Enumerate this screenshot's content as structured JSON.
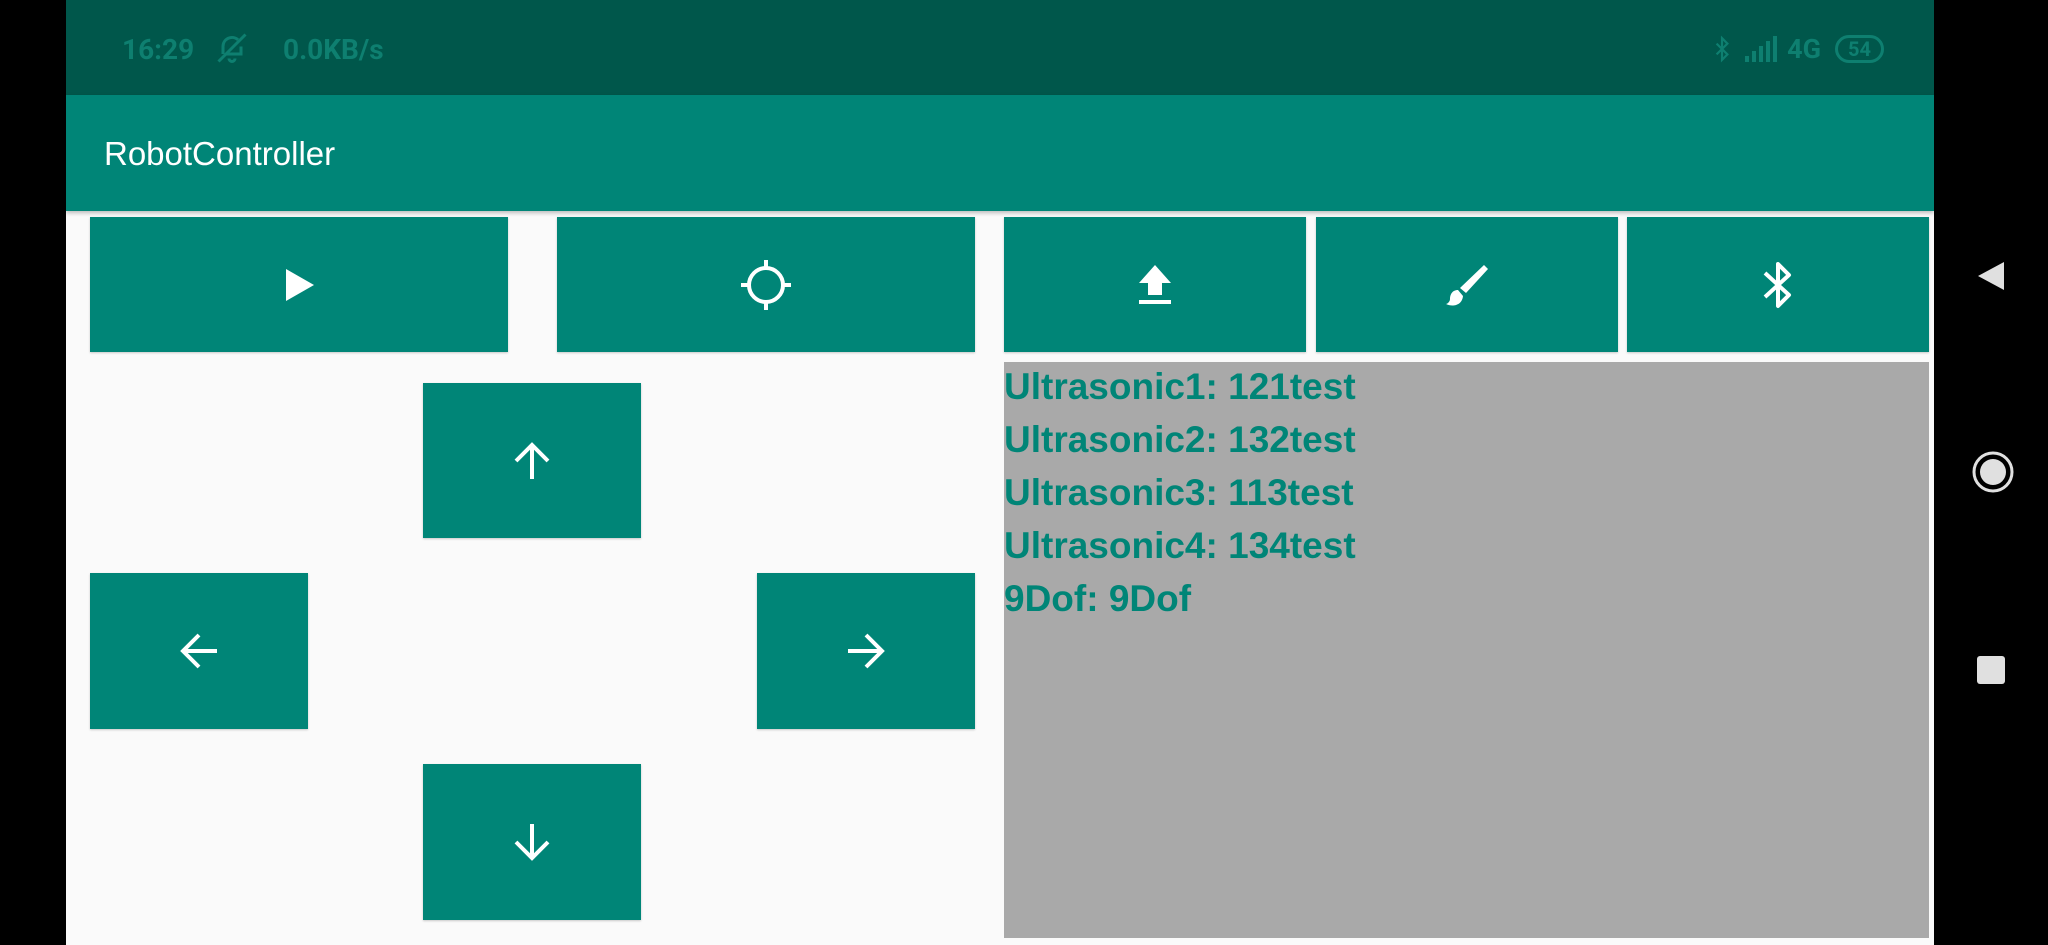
{
  "status_bar": {
    "time": "16:29",
    "network_speed": "0.0KB/s",
    "network_type": "4G",
    "battery": "54",
    "icons": [
      "dnd-off-icon",
      "bluetooth-icon",
      "signal-icon"
    ]
  },
  "app_bar": {
    "title": "RobotController"
  },
  "controls": {
    "top_buttons": [
      {
        "name": "play-button",
        "icon": "play-icon"
      },
      {
        "name": "target-button",
        "icon": "crosshair-icon"
      }
    ],
    "right_buttons": [
      {
        "name": "upload-button",
        "icon": "upload-icon"
      },
      {
        "name": "brush-button",
        "icon": "brush-icon"
      },
      {
        "name": "bluetooth-button",
        "icon": "bluetooth-icon"
      }
    ],
    "dpad": {
      "up": "arrow-up-icon",
      "left": "arrow-left-icon",
      "right": "arrow-right-icon",
      "down": "arrow-down-icon"
    }
  },
  "sensors": [
    "Ultrasonic1: 121test",
    "Ultrasonic2: 132test",
    "Ultrasonic3: 113test",
    "Ultrasonic4: 134test",
    "9Dof: 9Dof"
  ],
  "colors": {
    "primary": "#008577",
    "primary_dark": "#00574b",
    "background": "#fafafa",
    "panel": "#a9a9a9",
    "icon": "#ffffff"
  }
}
